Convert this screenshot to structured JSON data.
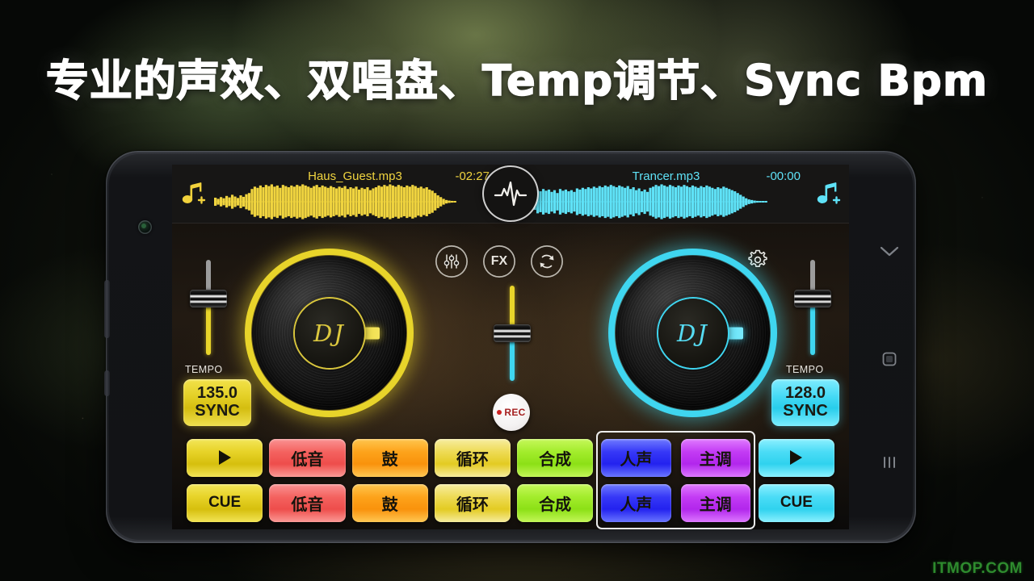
{
  "banner": {
    "headline": "专业的声效、双唱盘、Temp调节、Sync Bpm",
    "watermark": "ITMOP.COM"
  },
  "colors": {
    "deck_left_accent": "#e8d42a",
    "deck_right_accent": "#3fd6f0",
    "rec_red": "#cc2222",
    "watermark_green": "#2e8b2e"
  },
  "phone": {
    "nav": [
      {
        "name": "back-icon",
        "glyph": "chevron-down"
      },
      {
        "name": "home-icon",
        "glyph": "square"
      },
      {
        "name": "recents-icon",
        "glyph": "bars"
      }
    ]
  },
  "app": {
    "decks": {
      "left": {
        "track_title": "Haus_Guest.mp3",
        "remaining_time": "-02:27",
        "add_icon": "music-note-add-icon",
        "tempo_label": "TEMPO",
        "bpm": "135.0",
        "sync_label": "SYNC",
        "disc_label": "DJ",
        "waveform": [
          14,
          10,
          16,
          12,
          20,
          15,
          24,
          18,
          13,
          22,
          17,
          26,
          30,
          44,
          52,
          48,
          56,
          50,
          58,
          54,
          60,
          52,
          56,
          48,
          58,
          54,
          50,
          56,
          52,
          58,
          54,
          60,
          56,
          52,
          48,
          54,
          58,
          50,
          56,
          52,
          48,
          54,
          50,
          46,
          52,
          48,
          54,
          44,
          50,
          46,
          52,
          42,
          48,
          44,
          50,
          40,
          46,
          50,
          56,
          52,
          58,
          54,
          60,
          56,
          52,
          58,
          54,
          50,
          56,
          52,
          58,
          54,
          48,
          52,
          46,
          50,
          42,
          38,
          30,
          22,
          16,
          10,
          6,
          4,
          3,
          2
        ]
      },
      "right": {
        "track_title": "Trancer.mp3",
        "remaining_time": "-00:00",
        "add_icon": "music-note-add-icon",
        "tempo_label": "TEMPO",
        "bpm": "128.0",
        "sync_label": "SYNC",
        "disc_label": "DJ",
        "waveform": [
          4,
          6,
          10,
          28,
          40,
          36,
          44,
          38,
          42,
          34,
          40,
          30,
          44,
          38,
          42,
          36,
          40,
          34,
          46,
          42,
          48,
          44,
          50,
          46,
          52,
          48,
          54,
          50,
          56,
          52,
          58,
          54,
          50,
          56,
          52,
          48,
          54,
          44,
          50,
          40,
          46,
          36,
          42,
          34,
          48,
          52,
          58,
          54,
          60,
          56,
          52,
          58,
          54,
          50,
          56,
          52,
          58,
          54,
          50,
          56,
          52,
          48,
          54,
          50,
          56,
          52,
          48,
          44,
          50,
          46,
          52,
          48,
          44,
          40,
          36,
          30,
          24,
          18,
          12,
          8,
          6,
          4,
          3,
          2,
          2,
          1
        ]
      }
    },
    "center_tools": [
      {
        "name": "eq-button",
        "icon": "equalizer-sliders-icon",
        "label": ""
      },
      {
        "name": "fx-button",
        "icon": "fx-icon",
        "label": "FX"
      },
      {
        "name": "sync-loop-button",
        "icon": "circular-arrows-icon",
        "label": ""
      }
    ],
    "vu_button": {
      "name": "vu-meter-button",
      "icon": "pulse-waveform-icon"
    },
    "settings_button": {
      "name": "settings-button",
      "icon": "gear-icon"
    },
    "rec_button": {
      "label": "REC",
      "icon": "record-dot-icon"
    },
    "crossfader": {
      "name": "crossfader",
      "top_color": "#e8d42a",
      "bottom_color": "#3fd6f0"
    },
    "pads": {
      "columns": [
        {
          "name": "transport-left",
          "color": "c-yellow",
          "top": "",
          "top_icon": "play-icon",
          "bottom": "CUE",
          "highlight": false
        },
        {
          "name": "bass-left",
          "color": "c-red",
          "top": "低音",
          "bottom": "低音",
          "highlight": false
        },
        {
          "name": "drum-left",
          "color": "c-orange",
          "top": "鼓",
          "bottom": "鼓",
          "highlight": false
        },
        {
          "name": "loop-left",
          "color": "c-gold",
          "top": "循环",
          "bottom": "循环",
          "highlight": false
        },
        {
          "name": "synth-right",
          "color": "c-green",
          "top": "合成",
          "bottom": "合成",
          "highlight": false
        },
        {
          "name": "vocal-right",
          "color": "c-blue",
          "top": "人声",
          "bottom": "人声",
          "highlight": true
        },
        {
          "name": "melody-right",
          "color": "c-purple",
          "top": "主调",
          "bottom": "主调",
          "highlight": true
        },
        {
          "name": "transport-right",
          "color": "c-cyan",
          "top": "",
          "top_icon": "play-icon",
          "bottom": "CUE",
          "highlight": false
        }
      ]
    }
  }
}
